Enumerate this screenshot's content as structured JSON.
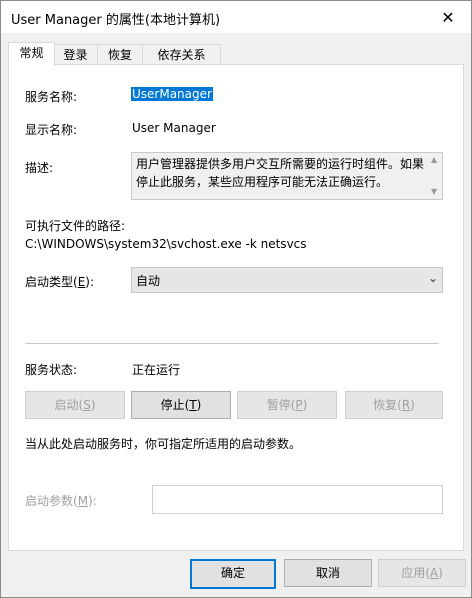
{
  "window": {
    "title": "User Manager 的属性(本地计算机)",
    "close_glyph": "✕"
  },
  "tabs": [
    {
      "label": "常规",
      "active": true
    },
    {
      "label": "登录",
      "active": false
    },
    {
      "label": "恢复",
      "active": false
    },
    {
      "label": "依存关系",
      "active": false
    }
  ],
  "general": {
    "service_name_label": "服务名称:",
    "service_name_value": "UserManager",
    "display_name_label": "显示名称:",
    "display_name_value": "User Manager",
    "description_label": "描述:",
    "description_value": "用户管理器提供多用户交互所需要的运行时组件。如果停止此服务，某些应用程序可能无法正确运行。",
    "exe_path_label": "可执行文件的路径:",
    "exe_path_value": "C:\\WINDOWS\\system32\\svchost.exe -k netsvcs",
    "startup_type_label_pre": "启动类型(",
    "startup_type_label_key": "E",
    "startup_type_label_post": "):",
    "startup_type_value": "自动",
    "status_label": "服务状态:",
    "status_value": "正在运行",
    "btn_start_pre": "启动(",
    "btn_start_key": "S",
    "btn_start_post": ")",
    "btn_stop_pre": "停止(",
    "btn_stop_key": "T",
    "btn_stop_post": ")",
    "btn_pause_pre": "暂停(",
    "btn_pause_key": "P",
    "btn_pause_post": ")",
    "btn_resume_pre": "恢复(",
    "btn_resume_key": "R",
    "btn_resume_post": ")",
    "hint_text": "当从此处启动服务时，你可指定所适用的启动参数。",
    "start_params_label_pre": "启动参数(",
    "start_params_label_key": "M",
    "start_params_label_post": "):",
    "start_params_value": ""
  },
  "footer": {
    "ok_label": "确定",
    "cancel_label": "取消",
    "apply_pre": "应用(",
    "apply_key": "A",
    "apply_post": ")"
  },
  "colors": {
    "accent": "#0078d7",
    "disabled_text": "#a0a0a0",
    "dialog_bg": "#f0f0f0"
  }
}
